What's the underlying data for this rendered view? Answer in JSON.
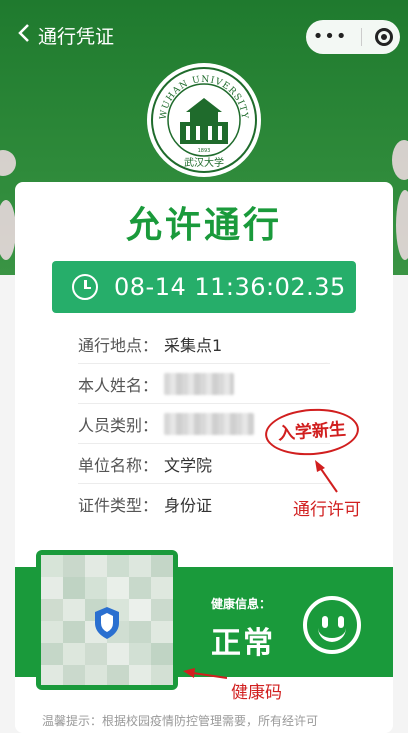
{
  "nav": {
    "back_label": "<",
    "title": "通行凭证"
  },
  "logo": {
    "top_text": "WUHAN UNIVERSITY",
    "year": "1893",
    "bottom_text": "武汉大学"
  },
  "permit": {
    "status": "允许通行",
    "datetime": "08-14 11:36:02.35"
  },
  "info_rows": [
    {
      "label": "通行地点：",
      "value": "采集点1"
    },
    {
      "label": "本人姓名：",
      "value": ""
    },
    {
      "label": "人员类别：",
      "value": ""
    },
    {
      "label": "单位名称：",
      "value": "文学院"
    },
    {
      "label": "证件类型：",
      "value": "身份证"
    }
  ],
  "stamp": {
    "text": "入学新生"
  },
  "annotations": {
    "pass": "通行许可",
    "health": "健康码"
  },
  "health": {
    "label": "健康信息：",
    "value": "正常"
  },
  "tip": "温馨提示：根据校园疫情防控管理需要，所有经许可",
  "colors": {
    "primary_green": "#1a9a3b",
    "time_bar": "#26ae6a",
    "stamp_red": "#d11f1f"
  }
}
